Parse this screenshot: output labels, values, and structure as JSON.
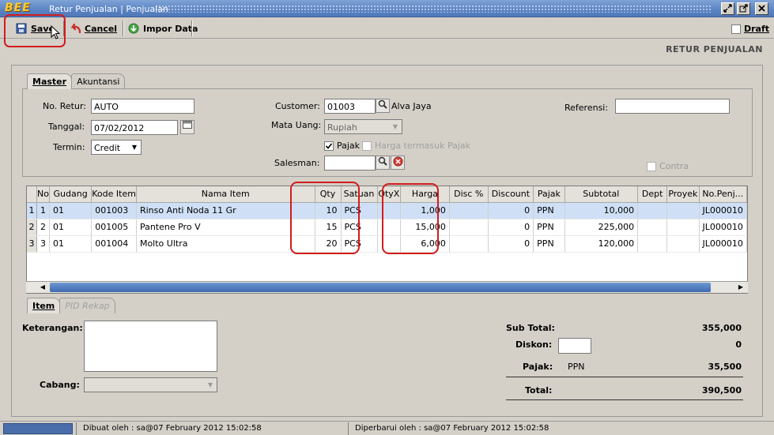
{
  "window": {
    "logo": "BEE",
    "title": "Retur Penjualan | Penjualan",
    "controls": [
      "restore-icon",
      "maximize-icon",
      "close-icon"
    ]
  },
  "toolbar": {
    "save_label": "Save",
    "cancel_label": "Cancel",
    "import_label": "Impor Data",
    "draft_label": "Draft",
    "draft_checked": false
  },
  "page_heading": "RETUR PENJUALAN",
  "tabs_top": [
    "Master",
    "Akuntansi"
  ],
  "master": {
    "no_retur_label": "No. Retur:",
    "no_retur_value": "AUTO",
    "tanggal_label": "Tanggal:",
    "tanggal_value": "07/02/2012",
    "termin_label": "Termin:",
    "termin_value": "Credit",
    "customer_label": "Customer:",
    "customer_code": "01003",
    "customer_name": "Alva Jaya",
    "mata_uang_label": "Mata Uang:",
    "mata_uang_value": "Rupiah",
    "pajak_label": "Pajak",
    "pajak_checked": true,
    "harga_pajak_label": "Harga termasuk Pajak",
    "harga_pajak_checked": false,
    "salesman_label": "Salesman:",
    "salesman_value": "",
    "referensi_label": "Referensi:",
    "referensi_value": "",
    "contra_label": "Contra",
    "contra_checked": false
  },
  "grid": {
    "columns": [
      "No",
      "Gudang",
      "Kode Item",
      "Nama Item",
      "Qty",
      "Satuan",
      "QtyX",
      "Harga",
      "Disc %",
      "Discount",
      "Pajak",
      "Subtotal",
      "Dept",
      "Proyek",
      "No.Penj..."
    ],
    "rows": [
      {
        "row_no": "1",
        "no": "1",
        "gudang": "01",
        "kode": "001003",
        "nama": "Rinso Anti Noda 11 Gr",
        "qty": "10",
        "satuan": "PCS",
        "qtyx": "",
        "harga": "1,000",
        "disc": "",
        "discount": "0",
        "pajak": "PPN",
        "subtotal": "10,000",
        "dept": "",
        "proyek": "",
        "no_penj": "JL000010"
      },
      {
        "row_no": "2",
        "no": "2",
        "gudang": "01",
        "kode": "001005",
        "nama": "Pantene Pro V",
        "qty": "15",
        "satuan": "PCS",
        "qtyx": "",
        "harga": "15,000",
        "disc": "",
        "discount": "0",
        "pajak": "PPN",
        "subtotal": "225,000",
        "dept": "",
        "proyek": "",
        "no_penj": "JL000010"
      },
      {
        "row_no": "3",
        "no": "3",
        "gudang": "01",
        "kode": "001004",
        "nama": "Molto Ultra",
        "qty": "20",
        "satuan": "PCS",
        "qtyx": "",
        "harga": "6,000",
        "disc": "",
        "discount": "0",
        "pajak": "PPN",
        "subtotal": "120,000",
        "dept": "",
        "proyek": "",
        "no_penj": "JL000010"
      }
    ]
  },
  "tabs_bottom": [
    "Item",
    "PID Rekap"
  ],
  "footer": {
    "keterangan_label": "Keterangan:",
    "cabang_label": "Cabang:",
    "subtotal_label": "Sub Total:",
    "subtotal_value": "355,000",
    "diskon_label": "Diskon:",
    "diskon_value": "0",
    "pajak_label": "Pajak:",
    "pajak_type": "PPN",
    "pajak_value": "35,500",
    "total_label": "Total:",
    "total_value": "390,500"
  },
  "status": {
    "dibuat": "Dibuat oleh : sa@07 February 2012  15:02:58",
    "diperbarui": "Diperbarui oleh : sa@07 February 2012  15:02:58"
  },
  "colors": {
    "highlight_ring": "#d21c1c",
    "title_bar": "#5b84c4",
    "selected_row": "#cfe0f6"
  }
}
